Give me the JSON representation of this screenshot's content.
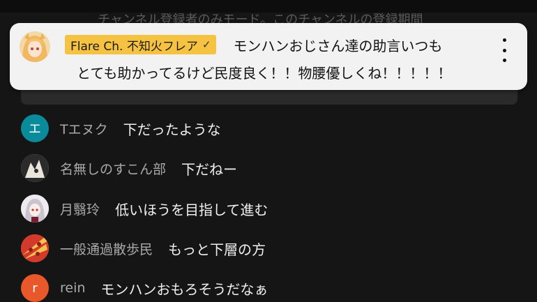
{
  "header": {
    "banner_text": "チャンネル登録者のみモード。このチャンネルの登録期間"
  },
  "pinned": {
    "author": "Flare Ch. 不知火フレア",
    "verified_mark": "✓",
    "message_line1": "モンハンおじさん達の助言いつも",
    "message_line2": "とても助かってるけど民度良く！！物腰優しくね！！！！！",
    "menu_icon": "more-vert-icon"
  },
  "messages": [
    {
      "avatar_letter": "エ",
      "avatar_color": "#0a8b9c",
      "name": "Tエヌク",
      "text": "下だったような"
    },
    {
      "avatar_letter": "",
      "avatar_color": "#d9d4cc",
      "name": "名無しのすこん部",
      "text": "下だねー"
    },
    {
      "avatar_letter": "",
      "avatar_color": "#e8e4ea",
      "name": "月翳玲",
      "text": "低いほうを目指して進む"
    },
    {
      "avatar_letter": "",
      "avatar_color": "#e3a33a",
      "name": "一般通過散歩民",
      "text": "もっと下層の方"
    },
    {
      "avatar_letter": "r",
      "avatar_color": "#e8582a",
      "name": "rein",
      "text": "モンハンおもろそうだなぁ"
    }
  ]
}
